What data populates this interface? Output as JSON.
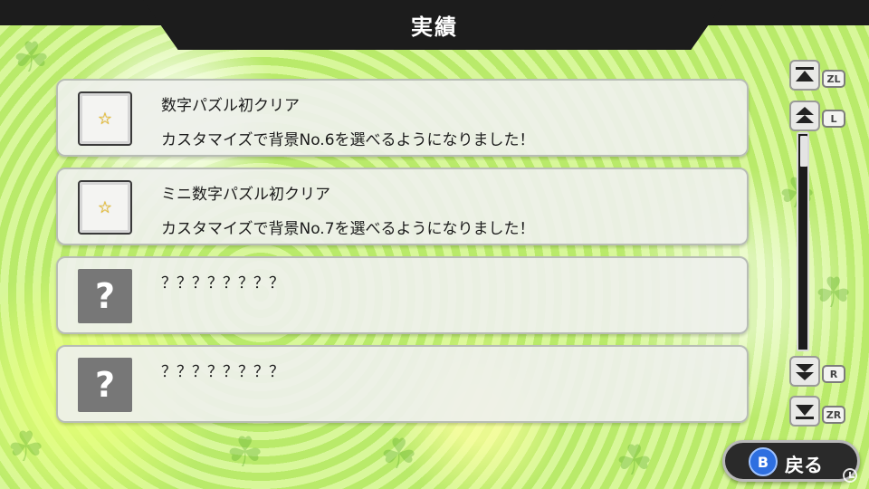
{
  "screen": {
    "title": "実績"
  },
  "achievements": [
    {
      "state": "unlocked",
      "icon": "star-icon",
      "title": "数字パズル初クリア",
      "description": "カスタマイズで背景No.6を選べるようになりました！"
    },
    {
      "state": "unlocked",
      "icon": "star-icon",
      "title": "ミニ数字パズル初クリア",
      "description": "カスタマイズで背景No.7を選べるようになりました！"
    },
    {
      "state": "locked",
      "icon": "question-mark-icon",
      "title": "？？？？？？？？",
      "description": ""
    },
    {
      "state": "locked",
      "icon": "question-mark-icon",
      "title": "？？？？？？？？",
      "description": ""
    }
  ],
  "scroll_controls": {
    "top_key": "ZL",
    "page_up_key": "L",
    "page_down_key": "R",
    "bottom_key": "ZR",
    "scroll_position": 0
  },
  "footer": {
    "back_key": "B",
    "back_label": "戻る"
  },
  "icons": {
    "unlocked": "☆",
    "locked": "?"
  },
  "colors": {
    "title_bar": "#1c1c1c",
    "back_button_key": "#2e6fe0",
    "star": "#f2c21a"
  }
}
